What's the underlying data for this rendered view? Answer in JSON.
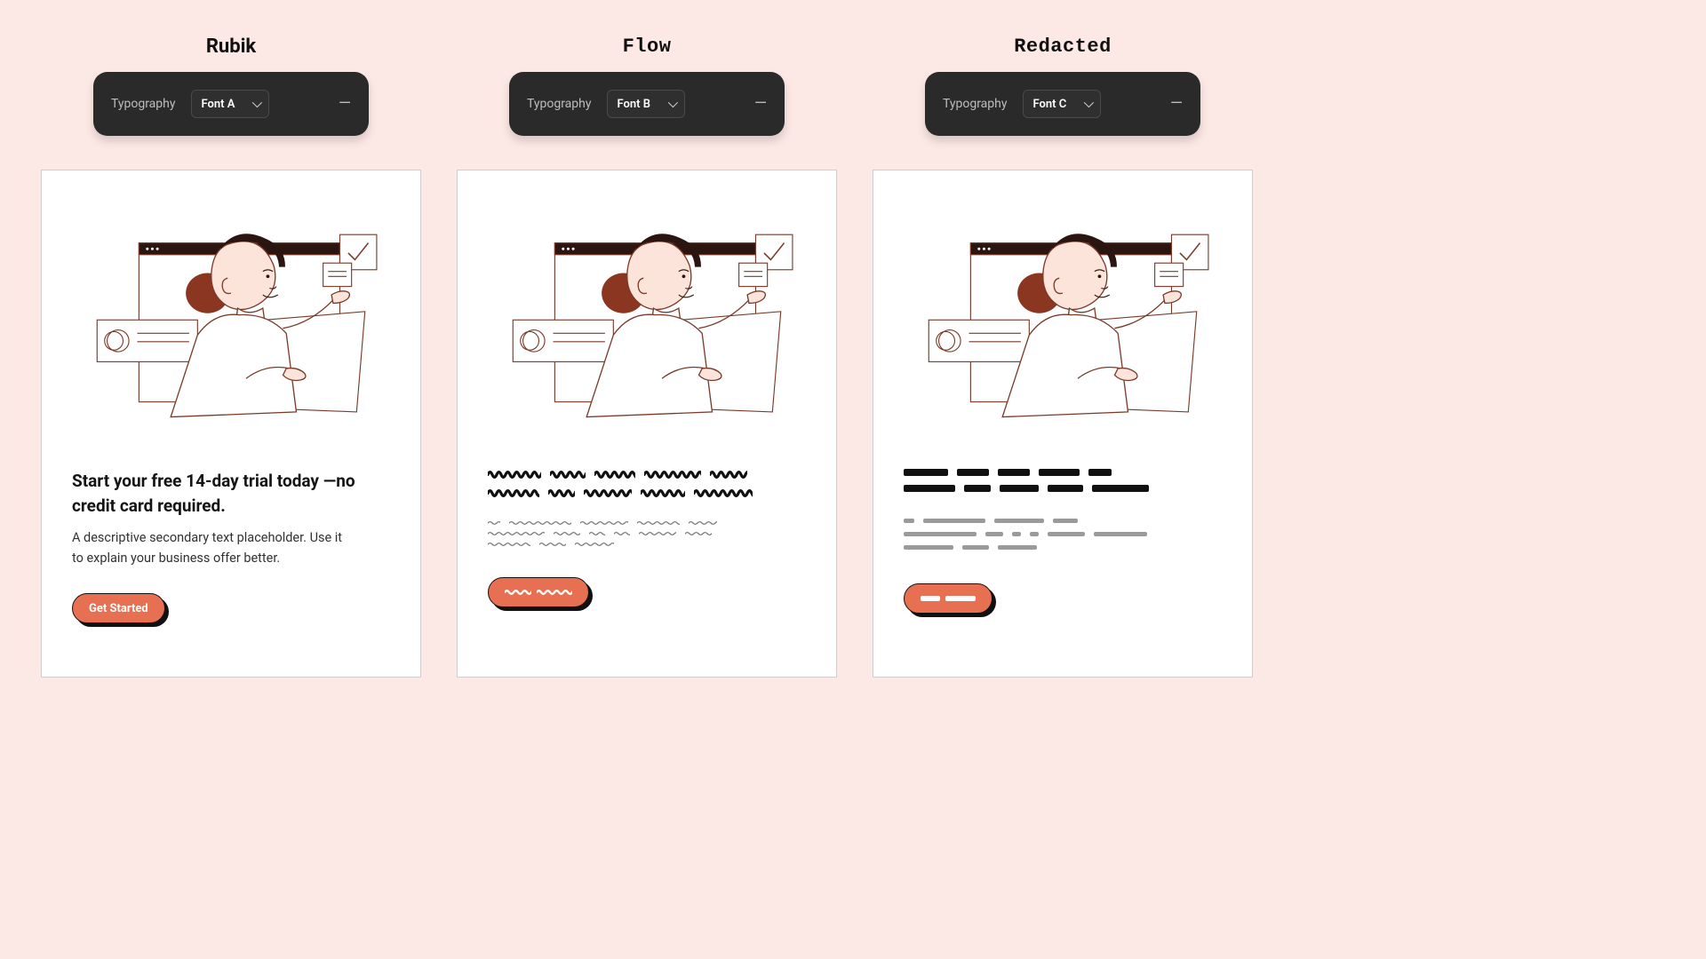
{
  "columns": [
    {
      "title": "Rubik",
      "toolbar": {
        "label": "Typography",
        "select": "Font A"
      },
      "card": {
        "heading": "Start your free 14-day trial today —no credit card required.",
        "subtext": "A descriptive secondary text placeholder. Use it to explain your business offer better.",
        "cta": "Get Started"
      }
    },
    {
      "title": "Flow",
      "toolbar": {
        "label": "Typography",
        "select": "Font B"
      },
      "card": {
        "style": "flow"
      }
    },
    {
      "title": "Redacted",
      "toolbar": {
        "label": "Typography",
        "select": "Font C"
      },
      "card": {
        "style": "redacted"
      }
    }
  ],
  "colors": {
    "accent": "#e77052",
    "bg": "#fce8e5"
  }
}
